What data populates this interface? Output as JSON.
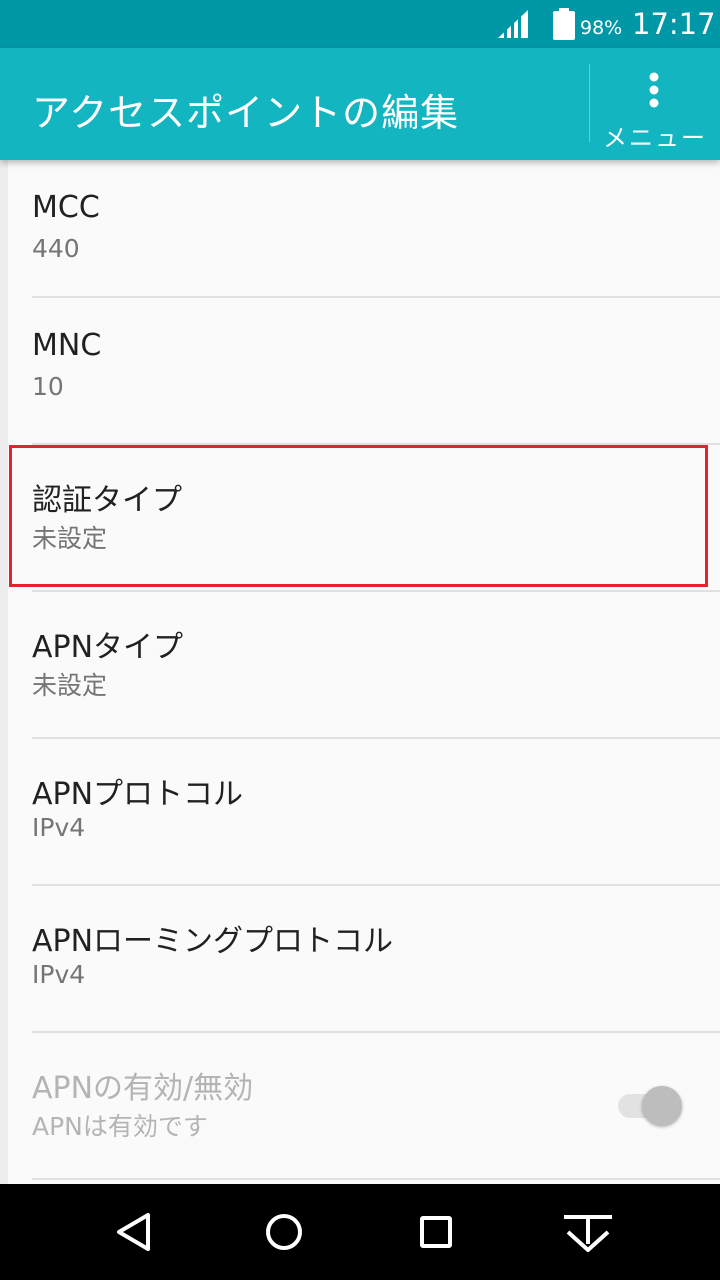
{
  "status_bar": {
    "battery_percent": "98%",
    "time": "17:17"
  },
  "app_bar": {
    "title": "アクセスポイントの編集",
    "menu_label": "メニュー"
  },
  "settings": [
    {
      "label": "MCC",
      "value": "440"
    },
    {
      "label": "MNC",
      "value": "10"
    },
    {
      "label": "認証タイプ",
      "value": "未設定"
    },
    {
      "label": "APNタイプ",
      "value": "未設定"
    },
    {
      "label": "APNプロトコル",
      "value": "IPv4"
    },
    {
      "label": "APNローミングプロトコル",
      "value": "IPv4"
    },
    {
      "label": "APNの有効/無効",
      "value": "APNは有効です"
    }
  ],
  "apn_toggle": {
    "enabled": true,
    "disabled_state": true
  },
  "colors": {
    "status_bar": "#0097a7",
    "app_bar": "#13b5c1",
    "highlight": "#e5222e"
  },
  "icons": {
    "signal": "signal-icon",
    "battery": "battery-icon",
    "menu": "more-vert-icon",
    "nav_back": "back-triangle-icon",
    "nav_home": "home-circle-icon",
    "nav_recents": "recents-square-icon",
    "nav_hide": "hide-nav-icon"
  }
}
